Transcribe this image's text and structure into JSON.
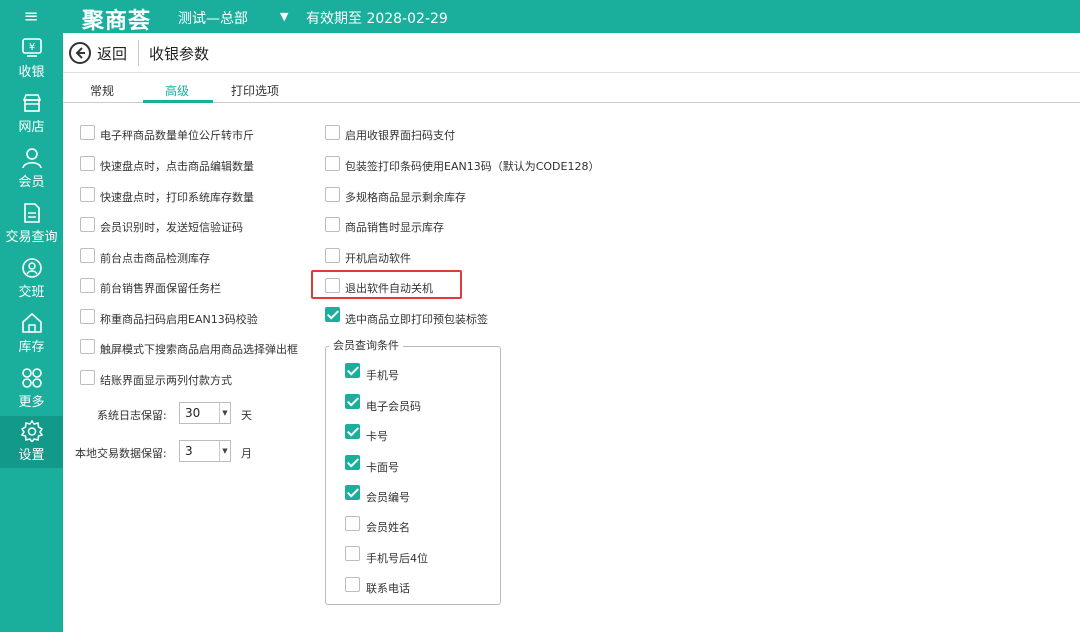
{
  "topbar": {
    "logo": "聚商荟",
    "store": "测试—总部",
    "expiry": "有效期至 2028-02-29"
  },
  "sidebar": {
    "items": [
      {
        "label": "收银",
        "icon": "cashier-icon"
      },
      {
        "label": "网店",
        "icon": "store-icon"
      },
      {
        "label": "会员",
        "icon": "member-icon"
      },
      {
        "label": "交易查询",
        "icon": "document-icon"
      },
      {
        "label": "交班",
        "icon": "handover-icon"
      },
      {
        "label": "库存",
        "icon": "warehouse-icon"
      },
      {
        "label": "更多",
        "icon": "more-icon"
      },
      {
        "label": "设置",
        "icon": "gear-icon"
      }
    ],
    "active": "设置"
  },
  "header": {
    "back_label": "返回",
    "title": "收银参数"
  },
  "tabs": [
    {
      "label": "常规",
      "active": false
    },
    {
      "label": "高级",
      "active": true
    },
    {
      "label": "打印选项",
      "active": false
    }
  ],
  "left_options": [
    {
      "label": "电子秤商品数量单位公斤转市斤",
      "checked": false
    },
    {
      "label": "快速盘点时，点击商品编辑数量",
      "checked": false
    },
    {
      "label": "快速盘点时，打印系统库存数量",
      "checked": false
    },
    {
      "label": "会员识别时，发送短信验证码",
      "checked": false
    },
    {
      "label": "前台点击商品检测库存",
      "checked": false
    },
    {
      "label": "前台销售界面保留任务栏",
      "checked": false
    },
    {
      "label": "称重商品扫码启用EAN13码校验",
      "checked": false
    },
    {
      "label": "触屏模式下搜索商品启用商品选择弹出框",
      "checked": false
    },
    {
      "label": "结账界面显示两列付款方式",
      "checked": false
    }
  ],
  "right_options": [
    {
      "label": "启用收银界面扫码支付",
      "checked": false
    },
    {
      "label": "包装签打印条码使用EAN13码（默认为CODE128）",
      "checked": false
    },
    {
      "label": "多规格商品显示剩余库存",
      "checked": false
    },
    {
      "label": "商品销售时显示库存",
      "checked": false
    },
    {
      "label": "开机启动软件",
      "checked": false
    },
    {
      "label": "退出软件自动关机",
      "checked": false
    },
    {
      "label": "选中商品立即打印预包装标签",
      "checked": true
    }
  ],
  "member_query": {
    "title": "会员查询条件",
    "options": [
      {
        "label": "手机号",
        "checked": true
      },
      {
        "label": "电子会员码",
        "checked": true
      },
      {
        "label": "卡号",
        "checked": true
      },
      {
        "label": "卡面号",
        "checked": true
      },
      {
        "label": "会员编号",
        "checked": true
      },
      {
        "label": "会员姓名",
        "checked": false
      },
      {
        "label": "手机号后4位",
        "checked": false
      },
      {
        "label": "联系电话",
        "checked": false
      }
    ]
  },
  "log_retention": {
    "label": "系统日志保留:",
    "value": "30",
    "unit": "天"
  },
  "local_data_retention": {
    "label": "本地交易数据保留:",
    "value": "3",
    "unit": "月"
  },
  "colors": {
    "accent": "#1aaf9d",
    "highlight": "#e53935"
  }
}
